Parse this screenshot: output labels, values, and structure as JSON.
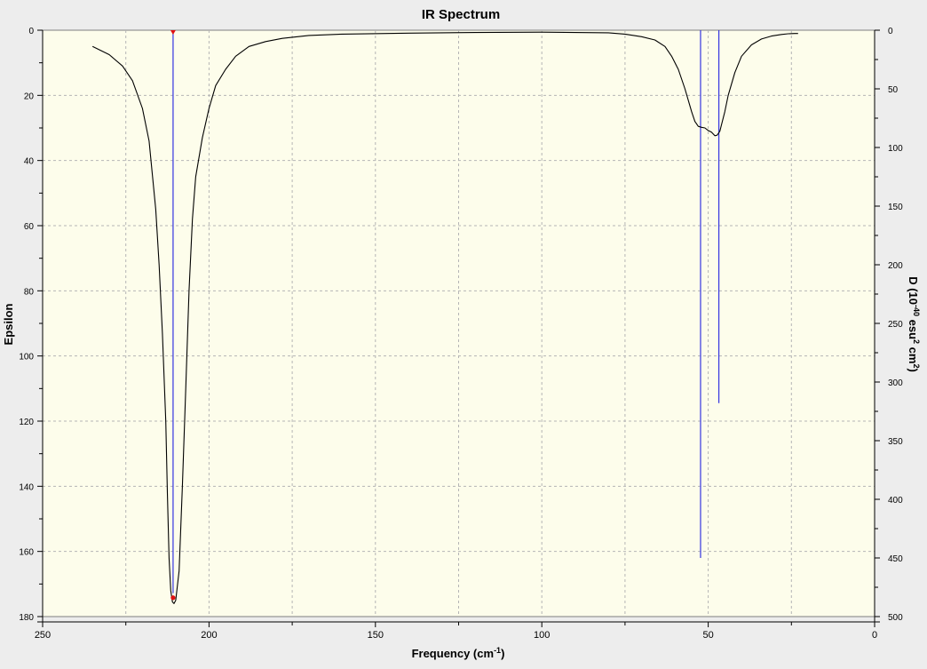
{
  "chart_data": {
    "type": "line",
    "title": "IR Spectrum",
    "xlabel_main": "Frequency (cm",
    "xlabel_sup": "-1",
    "xlabel_end": ")",
    "ylabel_left": "Epsilon",
    "ylabel_right_parts": [
      "D (10",
      "-40",
      " esu",
      "2",
      " cm",
      "2",
      ")"
    ],
    "xlim": [
      250,
      0
    ],
    "ylim_left": [
      0,
      180
    ],
    "ylim_right": [
      0,
      500
    ],
    "x_ticks": [
      250,
      200,
      150,
      100,
      50,
      0
    ],
    "y_left_ticks": [
      0,
      20,
      40,
      60,
      80,
      100,
      120,
      140,
      160,
      180
    ],
    "y_right_ticks": [
      0,
      50,
      100,
      150,
      200,
      250,
      300,
      350,
      400,
      450,
      500
    ],
    "grid": true,
    "colors": {
      "plot_bg": "#fdfdeb",
      "page_bg": "#ededed",
      "curve": "#000000",
      "sticks": "#3535e0",
      "marker": "#e01010",
      "grid": "#b5b5b5"
    },
    "spectrum_curve": {
      "name": "Epsilon",
      "x": [
        235,
        230,
        226,
        223,
        220,
        218,
        216,
        215,
        214,
        213,
        212.5,
        212,
        211.5,
        211,
        210.5,
        210,
        209,
        208,
        207,
        206,
        205,
        204,
        202,
        200,
        198,
        195,
        192,
        188,
        183,
        178,
        170,
        160,
        140,
        120,
        100,
        90,
        80,
        75,
        70,
        66,
        63,
        61,
        59,
        57,
        55,
        54,
        53,
        52,
        51,
        50,
        49,
        48,
        47.3,
        46.5,
        46,
        45,
        44,
        42,
        40,
        37,
        34,
        31,
        28,
        26,
        24,
        23
      ],
      "y": [
        5,
        7.5,
        11,
        15.5,
        24,
        34,
        55,
        72,
        93,
        120,
        142,
        162,
        172,
        175.5,
        176,
        175,
        166,
        140,
        110,
        80,
        58,
        45,
        33,
        24,
        17,
        12,
        8,
        5,
        3.5,
        2.5,
        1.6,
        1.2,
        0.9,
        0.7,
        0.6,
        0.7,
        0.8,
        1.2,
        2,
        3,
        5,
        8,
        12,
        18,
        25,
        28,
        29.5,
        29.8,
        30,
        30.8,
        31.3,
        32.4,
        32.2,
        31,
        29,
        25,
        20,
        13,
        8,
        4.5,
        2.7,
        1.8,
        1.3,
        1.1,
        1,
        1
      ],
      "peak_marker": {
        "x": 210.8,
        "y": 174.2
      }
    },
    "sticks": {
      "name": "D (10-40 esu2 cm2)",
      "x": [
        210.8,
        52.3,
        46.8
      ],
      "d": [
        480,
        450,
        318
      ]
    },
    "top_marker": {
      "x": 210.8
    }
  }
}
